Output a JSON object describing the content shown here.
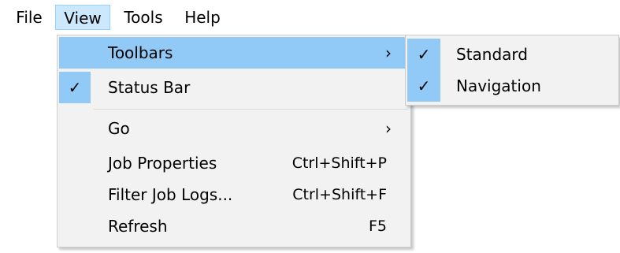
{
  "menubar": {
    "items": [
      "File",
      "View",
      "Tools",
      "Help"
    ],
    "active": "View"
  },
  "view_menu": {
    "items": [
      {
        "label": "Toolbars",
        "checked": false,
        "shortcut": "",
        "submenu": true,
        "highlighted": true
      },
      {
        "label": "Status Bar",
        "checked": true,
        "shortcut": "",
        "submenu": false,
        "highlighted": false
      },
      {
        "label": "Go",
        "checked": false,
        "shortcut": "",
        "submenu": true,
        "highlighted": false
      },
      {
        "label": "Job Properties",
        "checked": false,
        "shortcut": "Ctrl+Shift+P",
        "submenu": false,
        "highlighted": false
      },
      {
        "label": "Filter Job Logs...",
        "checked": false,
        "shortcut": "Ctrl+Shift+F",
        "submenu": false,
        "highlighted": false
      },
      {
        "label": "Refresh",
        "checked": false,
        "shortcut": "F5",
        "submenu": false,
        "highlighted": false
      }
    ],
    "check_glyph": "✓",
    "arrow_glyph": "›"
  },
  "toolbars_submenu": {
    "items": [
      {
        "label": "Standard",
        "checked": true
      },
      {
        "label": "Navigation",
        "checked": true
      }
    ]
  },
  "colors": {
    "highlight": "#91c9f7",
    "menubar_active": "#cce8ff",
    "menu_background": "#f2f2f2"
  },
  "icons": {
    "check": "checkmark-icon",
    "submenu_arrow": "chevron-right-icon"
  }
}
